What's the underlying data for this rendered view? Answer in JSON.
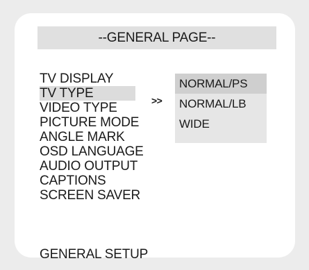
{
  "title": "--GENERAL PAGE--",
  "menu": {
    "items": [
      {
        "label": "TV DISPLAY"
      },
      {
        "label": "TV TYPE"
      },
      {
        "label": "VIDEO TYPE"
      },
      {
        "label": "PICTURE MODE"
      },
      {
        "label": "ANGLE MARK"
      },
      {
        "label": "OSD LANGUAGE"
      },
      {
        "label": "AUDIO OUTPUT"
      },
      {
        "label": "CAPTIONS"
      },
      {
        "label": "SCREEN SAVER"
      }
    ],
    "selected_index": 1
  },
  "submenu_arrow": ">>",
  "options": {
    "items": [
      {
        "label": "NORMAL/PS"
      },
      {
        "label": "NORMAL/LB"
      },
      {
        "label": "WIDE"
      }
    ],
    "selected_index": 0
  },
  "footer": {
    "label": "GENERAL SETUP"
  },
  "colors": {
    "background": "#ececec",
    "panel": "#ffffff",
    "title_bar": "#e0e0e0",
    "highlight": "#dcdcdc",
    "options_box": "#e6e6e6",
    "option_selected": "#cfcfcf",
    "text": "#1a1a1a"
  }
}
